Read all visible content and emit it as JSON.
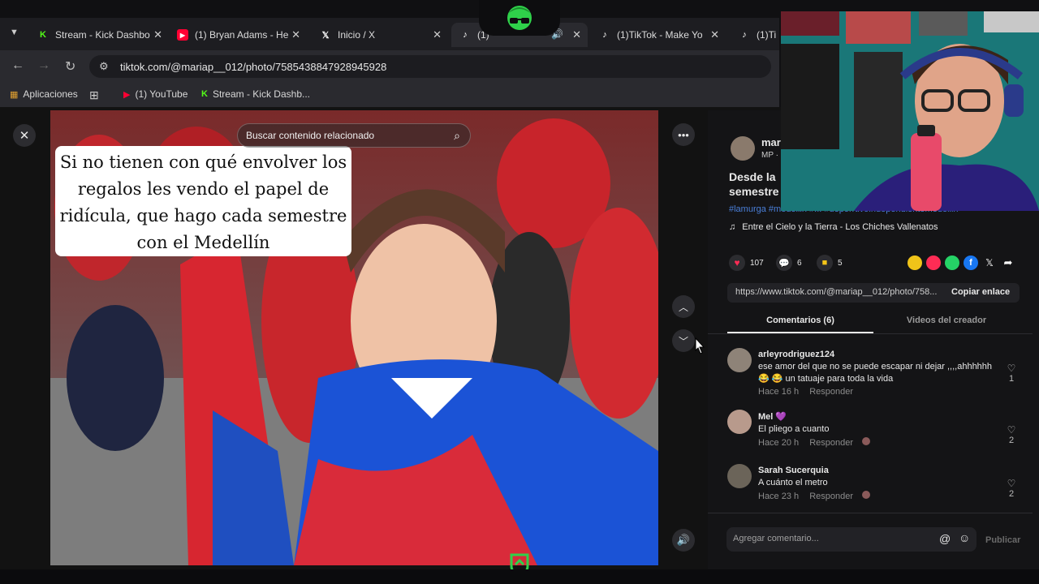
{
  "browser": {
    "tabs": [
      {
        "label": "Stream - Kick Dashbo",
        "icon": "kick-icon",
        "color": "#53fc18"
      },
      {
        "label": "(1) Bryan Adams - He",
        "icon": "youtube-icon",
        "color": "#ff0033"
      },
      {
        "label": "Inicio / X",
        "icon": "x-icon",
        "color": "#ffffff"
      },
      {
        "label": "(1)",
        "icon": "tiktok-icon",
        "color": "#ffffff"
      },
      {
        "label": "(1)TikTok - Make Yo",
        "icon": "tiktok-icon",
        "color": "#ffffff"
      },
      {
        "label": "(1)Ti",
        "icon": "tiktok-icon",
        "color": "#ffffff"
      }
    ],
    "url": "tiktok.com/@mariap__012/photo/7585438847928945928",
    "bookmarks": [
      {
        "label": "Aplicaciones"
      },
      {
        "label": "(1) YouTube"
      },
      {
        "label": "Stream - Kick Dashb..."
      }
    ]
  },
  "post": {
    "caption": "Si no tienen con qué envolver los regalos les vendo el papel de ridícula, que hago cada semestre con el Medellín",
    "search_placeholder": "Buscar contenido relacionado",
    "author_short": "mar",
    "author_initials": "MP ·",
    "title_line1": "Desde la",
    "title_line2": "semestre",
    "hashtags": "#lamurga #medellin #... #deporrtivoindependientemedellin",
    "music": "Entre el Cielo y la Tierra - Los Chiches Vallenatos",
    "likes": "107",
    "comments_count": "6",
    "saves": "5",
    "link": "https://www.tiktok.com/@mariap__012/photo/758...",
    "copy_link": "Copiar enlace",
    "tab_comments": "Comentarios (6)",
    "tab_creator": "Videos del creador"
  },
  "comments": [
    {
      "user": "arleyrodriguez124",
      "text": "ese amor del que no se puede escapar ni dejar ,,,,ahhhhhh 😂 😂 un tatuaje para toda la vida",
      "time": "Hace 16 h",
      "reply": "Responder",
      "likes": "1"
    },
    {
      "user": "Mel 💜",
      "text": "El pliego a cuanto",
      "time": "Hace 20 h",
      "reply": "Responder",
      "likes": "2"
    },
    {
      "user": "Sarah Sucerquia",
      "text": "A cuánto el metro",
      "time": "Hace 23 h",
      "reply": "Responder",
      "likes": "2"
    }
  ],
  "composer": {
    "placeholder": "Agregar comentario...",
    "publish": "Publicar"
  },
  "colors": {
    "accent": "#fe2c55",
    "kick": "#53fc18",
    "panel_bg": "#141416"
  }
}
